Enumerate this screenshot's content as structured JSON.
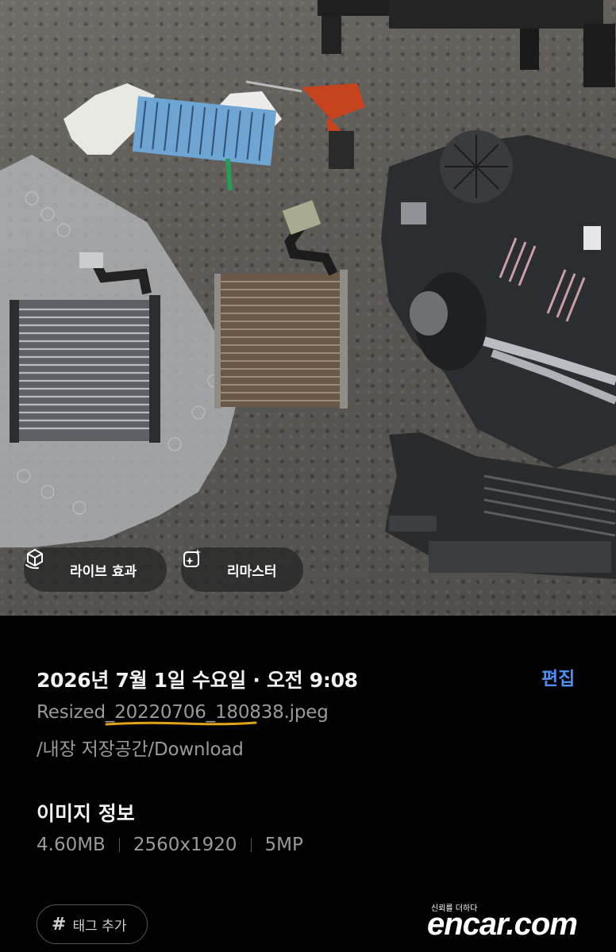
{
  "photo": {
    "buttons": {
      "live_effect": "라이브 효과",
      "remaster": "리마스터"
    },
    "icons": [
      "live-effect-icon",
      "remaster-icon"
    ]
  },
  "details": {
    "date": "2026년 7월 1일 수요일 · 오전 9:08",
    "edit_label": "편집",
    "filename": "Resized_20220706_180838.jpeg",
    "path": "/내장 저장공간/Download"
  },
  "image_info": {
    "title": "이미지 정보",
    "size": "4.60MB",
    "resolution": "2560x1920",
    "megapixels": "5MP"
  },
  "tags": {
    "add_label": "태그 추가",
    "icon": "#"
  },
  "watermark": {
    "tagline": "신뢰를 더하다",
    "brand": "encar.com"
  },
  "colors": {
    "accent": "#4f8df0",
    "underline": "#e0a21a",
    "background": "#000000"
  }
}
